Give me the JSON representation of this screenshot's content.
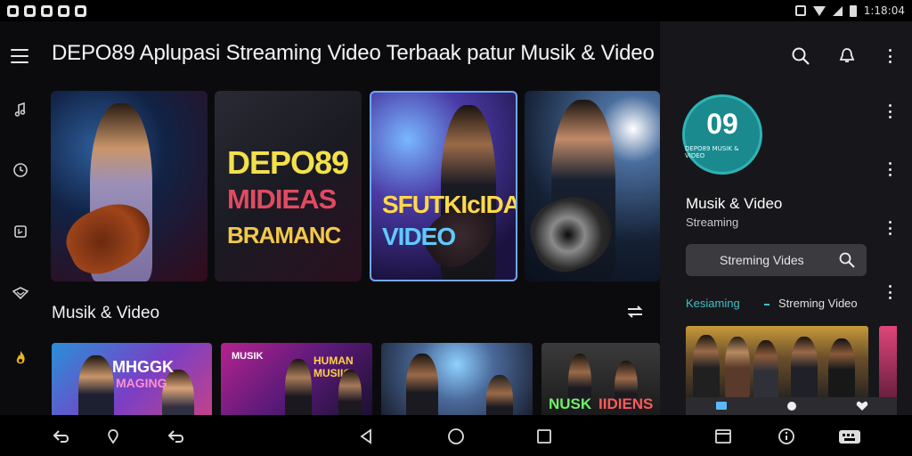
{
  "status_bar": {
    "time": "1:18:04",
    "left_icons": [
      "app-icon",
      "app-icon",
      "app-icon",
      "app-icon",
      "app-icon"
    ],
    "right_icons": [
      "vibrate-icon",
      "wifi-icon",
      "signal-icon",
      "battery-icon"
    ]
  },
  "header": {
    "title": "DEPO89 Aplupasi Streaming Video Terbaak patur Musik & Video",
    "actions": [
      "search-icon",
      "notification-icon",
      "more-icon"
    ]
  },
  "rail": {
    "items": [
      "menu-icon",
      "music-icon",
      "clock-icon",
      "playlist-icon",
      "badge-icon",
      "fire-icon"
    ]
  },
  "hero": {
    "tiles": [
      {
        "lines": []
      },
      {
        "lines": [
          "DEPO89",
          "MIDIEAS",
          "BRAMANC"
        ]
      },
      {
        "lines": [
          "SFUTKIcIDA",
          "VIDEO"
        ]
      },
      {
        "lines": []
      }
    ]
  },
  "section": {
    "title": "Musik & Video",
    "thumbs": [
      {
        "lines": [
          "MHGGK",
          "MAGING"
        ]
      },
      {
        "lines": [
          "MUSIK",
          "HUMAN",
          "MUSIIG"
        ]
      },
      {
        "lines": []
      },
      {
        "lines": [
          "NUSK",
          "IIDIENS"
        ]
      }
    ]
  },
  "panel": {
    "logo_number": "09",
    "logo_tagline": "DEPO89 MUSIK & VIDEO",
    "title": "Musik & Video",
    "subtitle": "Streaming",
    "search_label": "Streming Vides",
    "tab_active": "Kesiaming",
    "tab_other": "Streming Video"
  },
  "colors": {
    "accent": "#3ec1c8",
    "logo_bg": "#1a8a8f",
    "panel_bg": "#17171b",
    "background": "#0b0b0e"
  }
}
